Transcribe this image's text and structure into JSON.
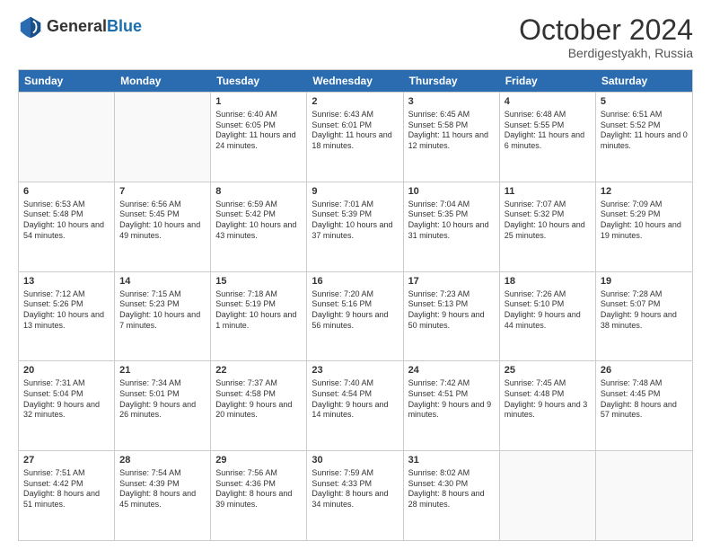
{
  "header": {
    "logo_general": "General",
    "logo_blue": "Blue",
    "month_title": "October 2024",
    "location": "Berdigestyakh, Russia"
  },
  "days_of_week": [
    "Sunday",
    "Monday",
    "Tuesday",
    "Wednesday",
    "Thursday",
    "Friday",
    "Saturday"
  ],
  "weeks": [
    [
      {
        "day": "",
        "sunrise": "",
        "sunset": "",
        "daylight": "",
        "empty": true
      },
      {
        "day": "",
        "sunrise": "",
        "sunset": "",
        "daylight": "",
        "empty": true
      },
      {
        "day": "1",
        "sunrise": "Sunrise: 6:40 AM",
        "sunset": "Sunset: 6:05 PM",
        "daylight": "Daylight: 11 hours and 24 minutes."
      },
      {
        "day": "2",
        "sunrise": "Sunrise: 6:43 AM",
        "sunset": "Sunset: 6:01 PM",
        "daylight": "Daylight: 11 hours and 18 minutes."
      },
      {
        "day": "3",
        "sunrise": "Sunrise: 6:45 AM",
        "sunset": "Sunset: 5:58 PM",
        "daylight": "Daylight: 11 hours and 12 minutes."
      },
      {
        "day": "4",
        "sunrise": "Sunrise: 6:48 AM",
        "sunset": "Sunset: 5:55 PM",
        "daylight": "Daylight: 11 hours and 6 minutes."
      },
      {
        "day": "5",
        "sunrise": "Sunrise: 6:51 AM",
        "sunset": "Sunset: 5:52 PM",
        "daylight": "Daylight: 11 hours and 0 minutes."
      }
    ],
    [
      {
        "day": "6",
        "sunrise": "Sunrise: 6:53 AM",
        "sunset": "Sunset: 5:48 PM",
        "daylight": "Daylight: 10 hours and 54 minutes."
      },
      {
        "day": "7",
        "sunrise": "Sunrise: 6:56 AM",
        "sunset": "Sunset: 5:45 PM",
        "daylight": "Daylight: 10 hours and 49 minutes."
      },
      {
        "day": "8",
        "sunrise": "Sunrise: 6:59 AM",
        "sunset": "Sunset: 5:42 PM",
        "daylight": "Daylight: 10 hours and 43 minutes."
      },
      {
        "day": "9",
        "sunrise": "Sunrise: 7:01 AM",
        "sunset": "Sunset: 5:39 PM",
        "daylight": "Daylight: 10 hours and 37 minutes."
      },
      {
        "day": "10",
        "sunrise": "Sunrise: 7:04 AM",
        "sunset": "Sunset: 5:35 PM",
        "daylight": "Daylight: 10 hours and 31 minutes."
      },
      {
        "day": "11",
        "sunrise": "Sunrise: 7:07 AM",
        "sunset": "Sunset: 5:32 PM",
        "daylight": "Daylight: 10 hours and 25 minutes."
      },
      {
        "day": "12",
        "sunrise": "Sunrise: 7:09 AM",
        "sunset": "Sunset: 5:29 PM",
        "daylight": "Daylight: 10 hours and 19 minutes."
      }
    ],
    [
      {
        "day": "13",
        "sunrise": "Sunrise: 7:12 AM",
        "sunset": "Sunset: 5:26 PM",
        "daylight": "Daylight: 10 hours and 13 minutes."
      },
      {
        "day": "14",
        "sunrise": "Sunrise: 7:15 AM",
        "sunset": "Sunset: 5:23 PM",
        "daylight": "Daylight: 10 hours and 7 minutes."
      },
      {
        "day": "15",
        "sunrise": "Sunrise: 7:18 AM",
        "sunset": "Sunset: 5:19 PM",
        "daylight": "Daylight: 10 hours and 1 minute."
      },
      {
        "day": "16",
        "sunrise": "Sunrise: 7:20 AM",
        "sunset": "Sunset: 5:16 PM",
        "daylight": "Daylight: 9 hours and 56 minutes."
      },
      {
        "day": "17",
        "sunrise": "Sunrise: 7:23 AM",
        "sunset": "Sunset: 5:13 PM",
        "daylight": "Daylight: 9 hours and 50 minutes."
      },
      {
        "day": "18",
        "sunrise": "Sunrise: 7:26 AM",
        "sunset": "Sunset: 5:10 PM",
        "daylight": "Daylight: 9 hours and 44 minutes."
      },
      {
        "day": "19",
        "sunrise": "Sunrise: 7:28 AM",
        "sunset": "Sunset: 5:07 PM",
        "daylight": "Daylight: 9 hours and 38 minutes."
      }
    ],
    [
      {
        "day": "20",
        "sunrise": "Sunrise: 7:31 AM",
        "sunset": "Sunset: 5:04 PM",
        "daylight": "Daylight: 9 hours and 32 minutes."
      },
      {
        "day": "21",
        "sunrise": "Sunrise: 7:34 AM",
        "sunset": "Sunset: 5:01 PM",
        "daylight": "Daylight: 9 hours and 26 minutes."
      },
      {
        "day": "22",
        "sunrise": "Sunrise: 7:37 AM",
        "sunset": "Sunset: 4:58 PM",
        "daylight": "Daylight: 9 hours and 20 minutes."
      },
      {
        "day": "23",
        "sunrise": "Sunrise: 7:40 AM",
        "sunset": "Sunset: 4:54 PM",
        "daylight": "Daylight: 9 hours and 14 minutes."
      },
      {
        "day": "24",
        "sunrise": "Sunrise: 7:42 AM",
        "sunset": "Sunset: 4:51 PM",
        "daylight": "Daylight: 9 hours and 9 minutes."
      },
      {
        "day": "25",
        "sunrise": "Sunrise: 7:45 AM",
        "sunset": "Sunset: 4:48 PM",
        "daylight": "Daylight: 9 hours and 3 minutes."
      },
      {
        "day": "26",
        "sunrise": "Sunrise: 7:48 AM",
        "sunset": "Sunset: 4:45 PM",
        "daylight": "Daylight: 8 hours and 57 minutes."
      }
    ],
    [
      {
        "day": "27",
        "sunrise": "Sunrise: 7:51 AM",
        "sunset": "Sunset: 4:42 PM",
        "daylight": "Daylight: 8 hours and 51 minutes."
      },
      {
        "day": "28",
        "sunrise": "Sunrise: 7:54 AM",
        "sunset": "Sunset: 4:39 PM",
        "daylight": "Daylight: 8 hours and 45 minutes."
      },
      {
        "day": "29",
        "sunrise": "Sunrise: 7:56 AM",
        "sunset": "Sunset: 4:36 PM",
        "daylight": "Daylight: 8 hours and 39 minutes."
      },
      {
        "day": "30",
        "sunrise": "Sunrise: 7:59 AM",
        "sunset": "Sunset: 4:33 PM",
        "daylight": "Daylight: 8 hours and 34 minutes."
      },
      {
        "day": "31",
        "sunrise": "Sunrise: 8:02 AM",
        "sunset": "Sunset: 4:30 PM",
        "daylight": "Daylight: 8 hours and 28 minutes."
      },
      {
        "day": "",
        "sunrise": "",
        "sunset": "",
        "daylight": "",
        "empty": true
      },
      {
        "day": "",
        "sunrise": "",
        "sunset": "",
        "daylight": "",
        "empty": true
      }
    ]
  ]
}
